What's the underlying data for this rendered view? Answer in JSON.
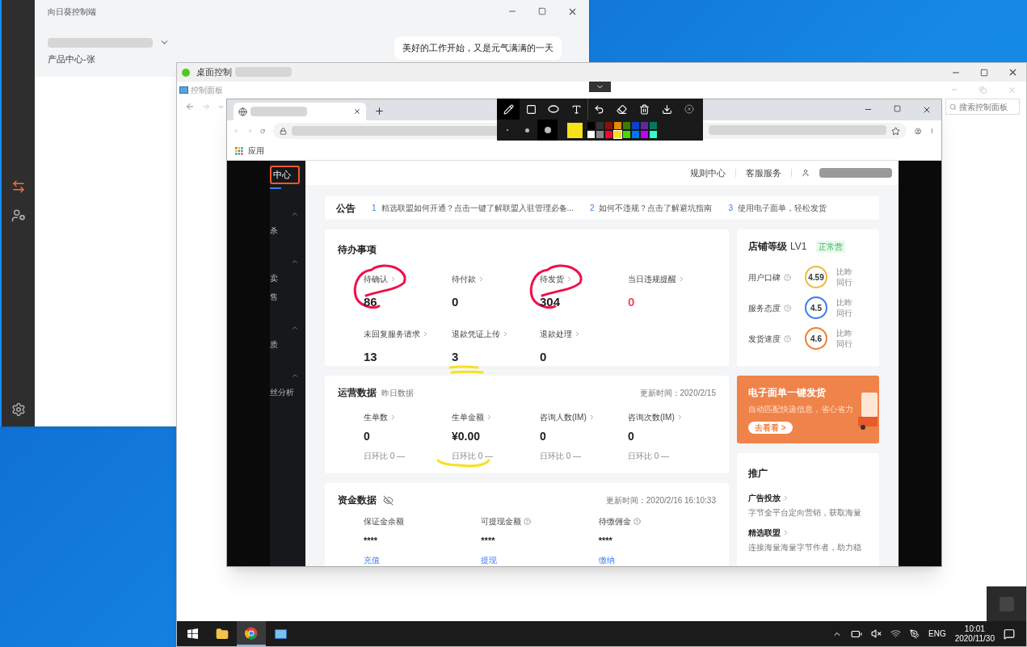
{
  "client_window": {
    "title": "向日葵控制端",
    "account_label": "产品中心-张",
    "greeting": "美好的工作开始，又是元气满满的一天"
  },
  "remote_window": {
    "title": "桌面控制"
  },
  "control_panel": {
    "title": "控制面板",
    "search_placeholder": "搜索控制面板"
  },
  "annotation_toolbar": {
    "tools": [
      {
        "kind": "pen",
        "selected": true
      },
      {
        "kind": "rect",
        "selected": false
      },
      {
        "kind": "ellipse",
        "selected": false
      },
      {
        "kind": "text",
        "selected": false
      },
      {
        "kind": "undo",
        "selected": false
      },
      {
        "kind": "eraser",
        "selected": false
      },
      {
        "kind": "trash",
        "selected": false
      },
      {
        "kind": "download",
        "selected": false
      },
      {
        "kind": "close",
        "selected": false
      }
    ],
    "sizes": [
      {
        "selected": false
      },
      {
        "selected": false
      },
      {
        "selected": true
      }
    ],
    "palette": [
      {
        "color": "#000000",
        "selected": false
      },
      {
        "color": "#333333",
        "selected": false
      },
      {
        "color": "#8b1010",
        "selected": false
      },
      {
        "color": "#e08c00",
        "selected": false
      },
      {
        "color": "#3a7d00",
        "selected": false
      },
      {
        "color": "#0a44cc",
        "selected": false
      },
      {
        "color": "#5b2aa0",
        "selected": false
      },
      {
        "color": "#007a5e",
        "selected": false
      },
      {
        "color": "#ffffff",
        "selected": false
      },
      {
        "color": "#888888",
        "selected": false
      },
      {
        "color": "#ff0033",
        "selected": false
      },
      {
        "color": "#f5e21b",
        "selected": true
      },
      {
        "color": "#44dd00",
        "selected": false
      },
      {
        "color": "#0077ff",
        "selected": false
      },
      {
        "color": "#c000ff",
        "selected": false
      },
      {
        "color": "#33ffcc",
        "selected": false
      }
    ]
  },
  "browser": {
    "bookmarks": [
      {
        "label": "应用"
      }
    ]
  },
  "sidebar": {
    "items": [
      {
        "kind": "link",
        "label": "中心",
        "selected": true
      },
      {
        "kind": "group",
        "expanded": true,
        "children": [
          {
            "label": "杀"
          }
        ]
      },
      {
        "kind": "group",
        "expanded": true,
        "children": [
          {
            "label": "卖"
          },
          {
            "label": "售"
          }
        ]
      },
      {
        "kind": "group",
        "expanded": true,
        "children": [
          {
            "label": "质"
          }
        ]
      },
      {
        "kind": "group",
        "expanded": true,
        "children": [
          {
            "label": "丝分析"
          }
        ]
      }
    ]
  },
  "header": {
    "links": [
      "规则中心",
      "客服服务"
    ]
  },
  "announcements": {
    "title": "公告",
    "items": [
      {
        "num": "1",
        "text": "精选联盟如何开通？点击一键了解联盟入驻管理必备..."
      },
      {
        "num": "2",
        "text": "如何不违规？点击了解避坑指南"
      },
      {
        "num": "3",
        "text": "使用电子面单，轻松发货"
      }
    ]
  },
  "todo": {
    "title": "待办事项",
    "items": [
      {
        "kind": "circled",
        "label": "待确认",
        "value": "86",
        "alert": false
      },
      {
        "kind": "plain",
        "label": "待付款",
        "value": "0",
        "alert": false
      },
      {
        "kind": "circled",
        "label": "待发货",
        "value": "304",
        "alert": false
      },
      {
        "kind": "plain",
        "label": "当日违规提醒",
        "value": "0",
        "alert": true
      },
      {
        "kind": "plain",
        "label": "未回复服务请求",
        "value": "13",
        "alert": false
      },
      {
        "kind": "doubleunderlined",
        "label": "退款凭证上传",
        "value": "3",
        "alert": false
      },
      {
        "kind": "plain",
        "label": "退款处理",
        "value": "0",
        "alert": false
      }
    ]
  },
  "operations": {
    "title": "运营数据",
    "subtitle": "昨日数据",
    "updated": "更新时间：2020/2/15",
    "items": [
      {
        "kind": "plain",
        "label": "生单数",
        "value": "0",
        "compare": "日环比 0 —"
      },
      {
        "kind": "underlined",
        "label": "生单金额",
        "value": "¥0.00",
        "compare": "日环比 0 —"
      },
      {
        "kind": "plain",
        "label": "咨询人数(IM)",
        "value": "0",
        "compare": "日环比 0 —"
      },
      {
        "kind": "plain",
        "label": "咨询次数(IM)",
        "value": "0",
        "compare": "日环比 0 —"
      }
    ]
  },
  "funds": {
    "title": "资金数据",
    "updated": "更新时间：2020/2/16 16:10:33",
    "items": [
      {
        "label": "保证金余额",
        "help": false,
        "value": "****",
        "action": "充值"
      },
      {
        "label": "可提现金额",
        "help": true,
        "value": "****",
        "action": "提现"
      },
      {
        "label": "待缴佣金",
        "help": true,
        "value": "****",
        "action": "缴纳"
      }
    ]
  },
  "store_level": {
    "title": "店铺等级",
    "level": "LV1",
    "status": "正常营",
    "metrics": [
      {
        "label": "用户口碑",
        "score": "4.59",
        "color": "#f0b840",
        "line1": "比昨",
        "line2": "同行"
      },
      {
        "label": "服务态度",
        "score": "4.5",
        "color": "#3b7cf0",
        "line1": "比昨",
        "line2": "同行"
      },
      {
        "label": "发货速度",
        "score": "4.6",
        "color": "#f08030",
        "line1": "比昨",
        "line2": "同行"
      }
    ]
  },
  "banner": {
    "title": "电子面单一键发货",
    "subtitle": "自动匹配快递信息，省心省力",
    "button": "去看看 >"
  },
  "promotion": {
    "title": "推广",
    "items": [
      {
        "title": "广告投放",
        "desc": "字节全平台定向营销，获取海量"
      },
      {
        "title": "精选联盟",
        "desc": "连接海量海量字节作者，助力稳"
      }
    ]
  },
  "taskbar": {
    "language": "ENG",
    "time": "10:01",
    "date": "2020/11/30"
  }
}
